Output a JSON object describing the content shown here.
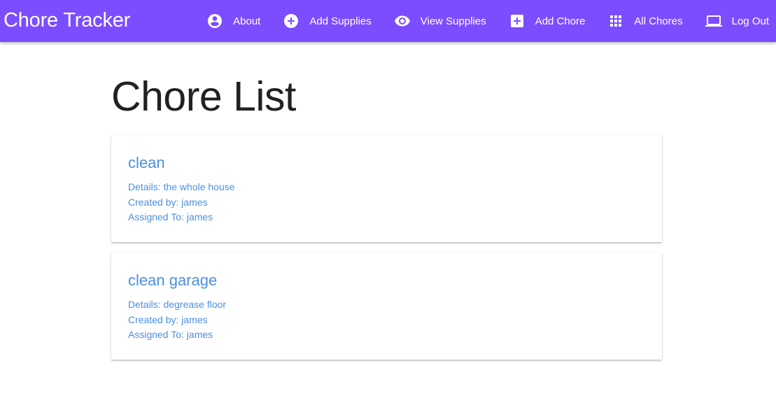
{
  "app": {
    "brand": "Chore Tracker"
  },
  "nav": {
    "items": [
      {
        "label": "About",
        "icon": "account-circle-icon"
      },
      {
        "label": "Add Supplies",
        "icon": "add-circle-icon"
      },
      {
        "label": "View Supplies",
        "icon": "eye-icon"
      },
      {
        "label": "Add Chore",
        "icon": "add-box-icon"
      },
      {
        "label": "All Chores",
        "icon": "grid-icon"
      },
      {
        "label": "Log Out",
        "icon": "laptop-icon"
      }
    ]
  },
  "page": {
    "title": "Chore List"
  },
  "chores": [
    {
      "title": "clean",
      "details": "Details: the whole house",
      "created_by": "Created by: james",
      "assigned_to": "Assigned To: james"
    },
    {
      "title": "clean garage",
      "details": "Details: degrease floor",
      "created_by": "Created by: james",
      "assigned_to": "Assigned To: james"
    }
  ],
  "colors": {
    "appbar": "#7c4dff",
    "link": "#4a90e2",
    "heading": "#212121"
  }
}
